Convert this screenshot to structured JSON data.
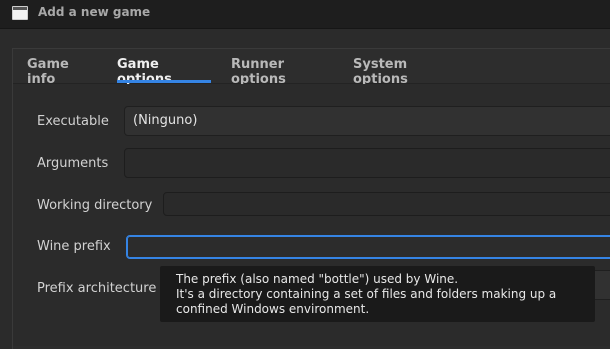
{
  "window": {
    "title": "Add a new game"
  },
  "tabs": [
    {
      "label": "Game info"
    },
    {
      "label": "Game options"
    },
    {
      "label": "Runner options"
    },
    {
      "label": "System options"
    }
  ],
  "form": {
    "executable": {
      "label": "Executable",
      "value": "(Ninguno)"
    },
    "arguments": {
      "label": "Arguments",
      "value": ""
    },
    "working_directory": {
      "label": "Working directory",
      "value": ""
    },
    "wine_prefix": {
      "label": "Wine prefix",
      "value": ""
    },
    "prefix_architecture": {
      "label": "Prefix architecture"
    }
  },
  "tooltip": {
    "line1": "The prefix (also named \"bottle\") used by Wine.",
    "line2": "It's a directory containing a set of files and folders making up a",
    "line3": "confined Windows environment."
  },
  "colors": {
    "accent": "#3584e4",
    "background": "#2b2b2b",
    "titlebar": "#1e1e1e",
    "tooltip": "#1a1a1a"
  },
  "icons": {
    "window": "window-icon"
  }
}
